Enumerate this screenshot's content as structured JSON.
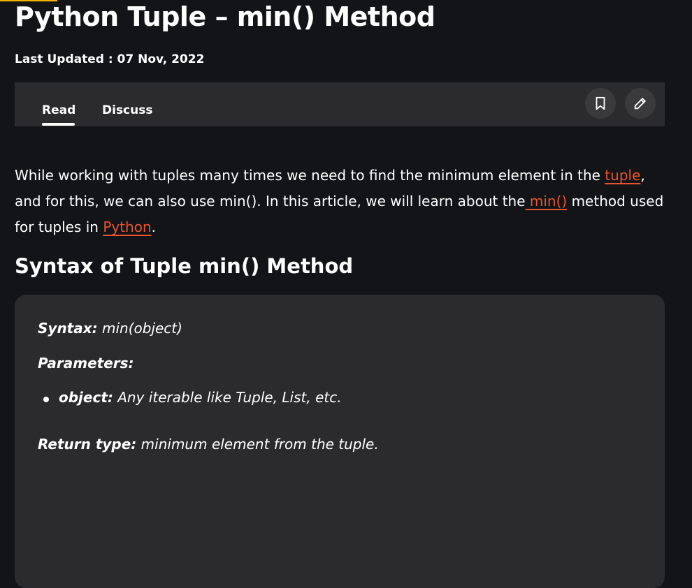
{
  "article": {
    "title": "Python Tuple – min() Method",
    "last_updated": "Last Updated : 07 Nov, 2022"
  },
  "tabs": [
    {
      "label": "Read",
      "active": true
    },
    {
      "label": "Discuss",
      "active": false
    }
  ],
  "actions": {
    "bookmark_icon": "bookmark-icon",
    "edit_icon": "pencil-icon"
  },
  "intro": {
    "part1": "While working with tuples many times we need to find the minimum element in the ",
    "link1": "tuple",
    "part2": ", and for this, we can also use min(). In this article, we will learn about the",
    "link2": " min()",
    "part3": " method used for tuples in ",
    "link3": "Python",
    "part4": "."
  },
  "section": {
    "heading": "Syntax of Tuple min() Method"
  },
  "syntax": {
    "syntax_label": "Syntax:",
    "syntax_value": " min(object)",
    "params_label": "Parameters:",
    "param_name": "object:",
    "param_desc": " Any iterable like Tuple, List, etc.",
    "return_label": "Return type:",
    "return_value": " minimum element from the tuple."
  },
  "colors": {
    "background": "#131417",
    "panel": "#2b2b2d",
    "link": "#e9542f",
    "accent": "#f5b400"
  }
}
